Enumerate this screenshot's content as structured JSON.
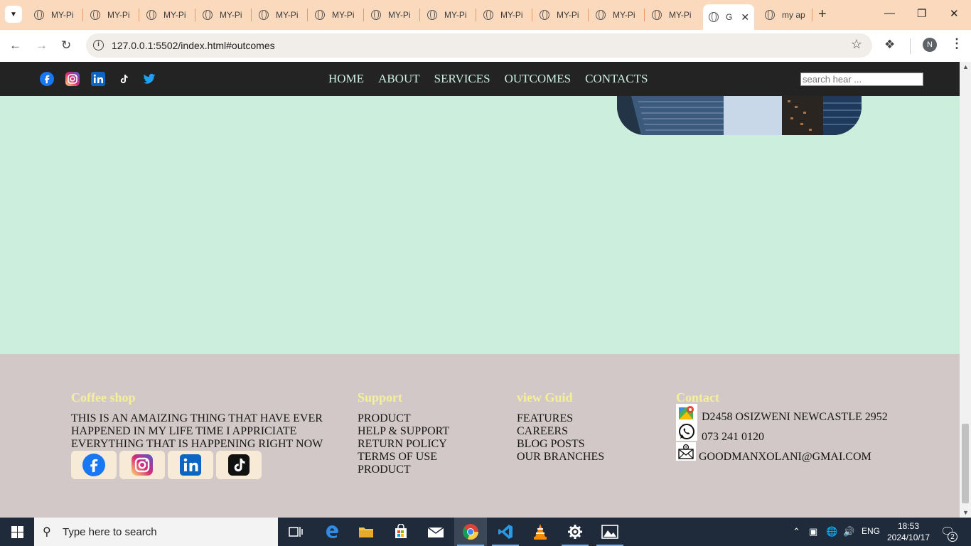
{
  "browser": {
    "tabs": [
      {
        "label": "MY-Pi",
        "active": false
      },
      {
        "label": "MY-Pi",
        "active": false
      },
      {
        "label": "MY-Pi",
        "active": false
      },
      {
        "label": "MY-Pi",
        "active": false
      },
      {
        "label": "MY-Pi",
        "active": false
      },
      {
        "label": "MY-Pi",
        "active": false
      },
      {
        "label": "MY-Pi",
        "active": false
      },
      {
        "label": "MY-Pi",
        "active": false
      },
      {
        "label": "MY-Pi",
        "active": false
      },
      {
        "label": "MY-Pi",
        "active": false
      },
      {
        "label": "MY-Pi",
        "active": false
      },
      {
        "label": "MY-Pi",
        "active": false
      },
      {
        "label": "G",
        "active": true
      },
      {
        "label": "my ap",
        "active": false
      }
    ],
    "url": "127.0.0.1:5502/index.html#outcomes",
    "profile_initial": "N",
    "accent": "#fbd9bd"
  },
  "site": {
    "nav_links": [
      "HOME",
      "ABOUT",
      "SERVICES",
      "OUTCOMES",
      "CONTACTS"
    ],
    "search_placeholder": "search hear ...",
    "social_icons": [
      "facebook-icon",
      "instagram-icon",
      "linkedin-icon",
      "tiktok-icon",
      "twitter-icon"
    ],
    "background": "#cbefdc"
  },
  "footer": {
    "coffee": {
      "heading": "Coffee shop",
      "lines": [
        "THIS IS AN AMAIZING THING THAT HAVE EVER",
        "HAPPENED IN MY LIFE TIME I APPRICIATE",
        "EVERYTHING THAT IS HAPPENING RIGHT NOW"
      ]
    },
    "support": {
      "heading": "Support",
      "items": [
        "PRODUCT",
        "HELP & SUPPORT",
        "RETURN POLICY",
        "TERMS OF USE",
        "PRODUCT"
      ]
    },
    "guide": {
      "heading": "view Guid",
      "items": [
        "FEATURES",
        "CAREERS",
        "BLOG POSTS",
        "OUR BRANCHES"
      ]
    },
    "contact": {
      "heading": "Contact",
      "address": "D2458 OSIZWENI NEWCASTLE 2952",
      "phone": "073 241 0120",
      "email": "GOODMANXOLANI@GMAI.COM"
    },
    "heading_color": "#f5ef9c"
  },
  "taskbar": {
    "search_placeholder": "Type here to search",
    "language": "ENG",
    "time": "18:53",
    "date": "2024/10/17",
    "notifications": "2"
  }
}
